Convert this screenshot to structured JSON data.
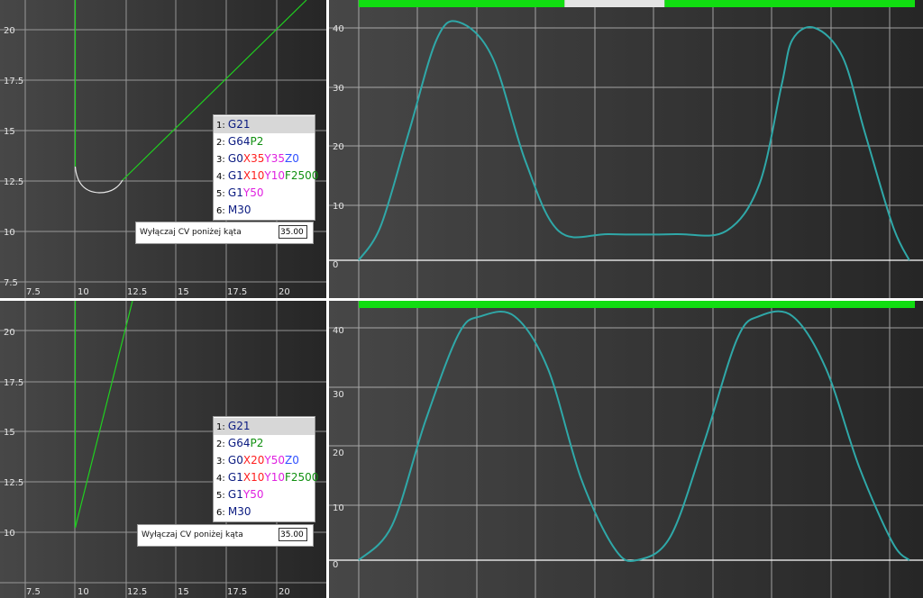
{
  "colors": {
    "gcode_default": "#0a1a80",
    "gcode_x": "#ff2020",
    "gcode_y": "#e020e0",
    "gcode_z": "#3050ff",
    "gcode_f": "#109010",
    "gcode_p": "#109010",
    "path_line": "#1fd11f",
    "arc": "#e8e8e8",
    "velocity_curve": "#2fa8a8",
    "progress_active": "#11dd11",
    "progress_idle": "#e4e4e4"
  },
  "top": {
    "path_view": {
      "x_ticks": [
        "7.5",
        "10",
        "12.5",
        "15",
        "17.5",
        "20"
      ],
      "y_ticks": [
        "20",
        "17.5",
        "15",
        "12.5",
        "10",
        "7.5"
      ],
      "gcode_lines": [
        {
          "num": "1:",
          "parts": [
            {
              "t": "G21",
              "c": "gcode_default"
            }
          ]
        },
        {
          "num": "2:",
          "parts": [
            {
              "t": "G64",
              "c": "gcode_default"
            },
            {
              "t": "P2",
              "c": "gcode_p"
            }
          ]
        },
        {
          "num": "3:",
          "parts": [
            {
              "t": "G0",
              "c": "gcode_default"
            },
            {
              "t": "X35",
              "c": "gcode_x"
            },
            {
              "t": "Y35",
              "c": "gcode_y"
            },
            {
              "t": "Z0",
              "c": "gcode_z"
            }
          ]
        },
        {
          "num": "4:",
          "parts": [
            {
              "t": "G1",
              "c": "gcode_default"
            },
            {
              "t": "X10",
              "c": "gcode_x"
            },
            {
              "t": "Y10",
              "c": "gcode_y"
            },
            {
              "t": "F2500",
              "c": "gcode_f"
            }
          ]
        },
        {
          "num": "5:",
          "parts": [
            {
              "t": "G1",
              "c": "gcode_default"
            },
            {
              "t": "Y50",
              "c": "gcode_y"
            }
          ]
        },
        {
          "num": "6:",
          "parts": [
            {
              "t": "M30",
              "c": "gcode_default"
            }
          ]
        }
      ],
      "selected_line": 0,
      "cv_label": "Wyłączaj CV poniżej kąta",
      "cv_value": "35.00"
    },
    "velocity_view": {
      "y_ticks": [
        "40",
        "30",
        "20",
        "10",
        "0"
      ],
      "progress_segments": [
        {
          "start": 0.0,
          "end": 0.37,
          "state": "active"
        },
        {
          "start": 0.37,
          "end": 0.55,
          "state": "idle"
        },
        {
          "start": 0.55,
          "end": 1.0,
          "state": "active"
        }
      ],
      "chart_data": {
        "type": "line",
        "series": [
          {
            "x": [
              0,
              4,
              9,
              14,
              18,
              24,
              30,
              36,
              45,
              57,
              66,
              72,
              76,
              78,
              82,
              87,
              91,
              96,
              99
            ],
            "y": [
              0,
              6,
              22,
              38,
              41,
              35,
              17,
              5,
              4.5,
              4.5,
              5,
              13,
              30,
              38,
              40,
              35,
              22,
              6,
              0
            ]
          }
        ],
        "ylim": [
          0,
          45
        ],
        "xlim": [
          0,
          100
        ],
        "y_ticks": [
          0,
          10,
          20,
          30,
          40
        ]
      }
    }
  },
  "bottom": {
    "path_view": {
      "x_ticks": [
        "7.5",
        "10",
        "12.5",
        "15",
        "17.5",
        "20"
      ],
      "y_ticks": [
        "20",
        "17.5",
        "15",
        "12.5",
        "10"
      ],
      "gcode_lines": [
        {
          "num": "1:",
          "parts": [
            {
              "t": "G21",
              "c": "gcode_default"
            }
          ]
        },
        {
          "num": "2:",
          "parts": [
            {
              "t": "G64",
              "c": "gcode_default"
            },
            {
              "t": "P2",
              "c": "gcode_p"
            }
          ]
        },
        {
          "num": "3:",
          "parts": [
            {
              "t": "G0",
              "c": "gcode_default"
            },
            {
              "t": "X20",
              "c": "gcode_x"
            },
            {
              "t": "Y50",
              "c": "gcode_y"
            },
            {
              "t": "Z0",
              "c": "gcode_z"
            }
          ]
        },
        {
          "num": "4:",
          "parts": [
            {
              "t": "G1",
              "c": "gcode_default"
            },
            {
              "t": "X10",
              "c": "gcode_x"
            },
            {
              "t": "Y10",
              "c": "gcode_y"
            },
            {
              "t": "F2500",
              "c": "gcode_f"
            }
          ]
        },
        {
          "num": "5:",
          "parts": [
            {
              "t": "G1",
              "c": "gcode_default"
            },
            {
              "t": "Y50",
              "c": "gcode_y"
            }
          ]
        },
        {
          "num": "6:",
          "parts": [
            {
              "t": "M30",
              "c": "gcode_default"
            }
          ]
        }
      ],
      "selected_line": 0,
      "cv_label": "Wyłączaj CV poniżej kąta",
      "cv_value": "35.00"
    },
    "velocity_view": {
      "y_ticks": [
        "40",
        "30",
        "20",
        "10",
        "0"
      ],
      "progress_segments": [
        {
          "start": 0.0,
          "end": 1.0,
          "state": "active"
        }
      ],
      "chart_data": {
        "type": "line",
        "series": [
          {
            "x": [
              0,
              6,
              12,
              18,
              22,
              28,
              34,
              40,
              46,
              50,
              56,
              62,
              68,
              72,
              78,
              84,
              90,
              96,
              99
            ],
            "y": [
              0,
              6,
              24,
              39,
              42,
              42,
              33,
              14,
              2,
              0,
              4,
              20,
              38,
              42,
              42,
              33,
              16,
              3,
              0
            ]
          }
        ],
        "ylim": [
          0,
          45
        ],
        "xlim": [
          0,
          100
        ],
        "y_ticks": [
          0,
          10,
          20,
          30,
          40
        ]
      }
    }
  }
}
